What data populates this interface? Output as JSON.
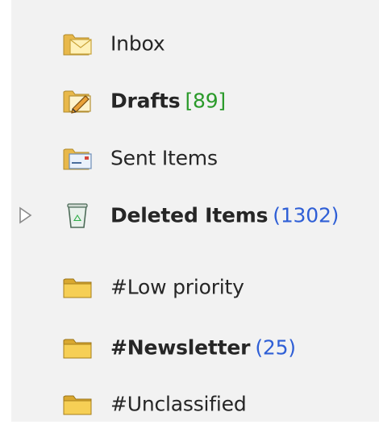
{
  "folders": [
    {
      "name": "Inbox",
      "count": "",
      "icon": "inbox-icon"
    },
    {
      "name": "Drafts",
      "count": "[89]",
      "icon": "drafts-icon"
    },
    {
      "name": "Sent Items",
      "count": "",
      "icon": "sent-items-icon"
    },
    {
      "name": "Deleted Items",
      "count": "(1302)",
      "icon": "recycle-bin-icon"
    },
    {
      "name": "#Low priority",
      "count": "",
      "icon": "folder-icon"
    },
    {
      "name": "#Newsletter",
      "count": "(25)",
      "icon": "folder-icon"
    },
    {
      "name": "#Unclassified",
      "count": "",
      "icon": "folder-icon"
    }
  ],
  "colors": {
    "count_green": "#2a9a2a",
    "count_blue": "#2f5fd6",
    "folder_yellow": "#f3c84a"
  }
}
